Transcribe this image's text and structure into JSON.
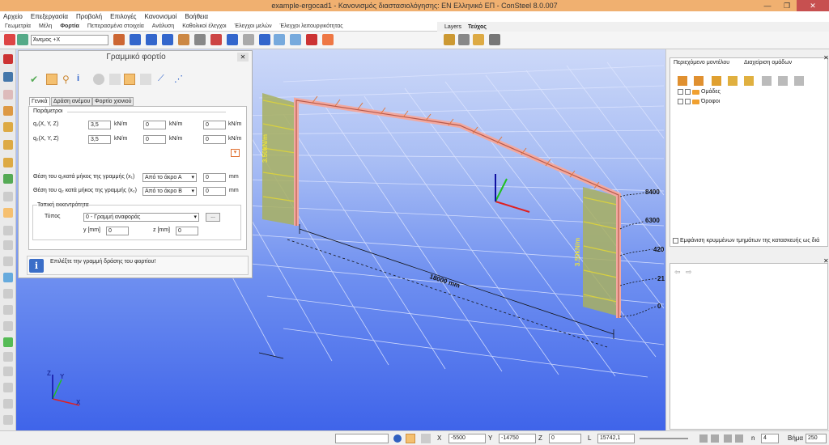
{
  "window": {
    "title": "example-ergocad1 - Κανονισμός διαστασιολόγησης: EN Ελληνικό ΕΠ - ConSteel 8.0.007",
    "controls": [
      "—",
      "❐",
      "✕"
    ]
  },
  "menu": [
    "Αρχείο",
    "Επεξεργασία",
    "Προβολή",
    "Επιλογές",
    "Κανονισμοί",
    "Βοήθεια"
  ],
  "ribbon_tabs": [
    "Γεωμετρία",
    "Μέλη",
    "Φορτία",
    "Πεπερασμένα στοιχεία",
    "Ανάλυση",
    "Καθολικοί έλεγχοι",
    "Έλεγχοι μελών",
    "Έλεγχοι λειτουργικότητας"
  ],
  "ribbon_tabs_right": [
    "Layers",
    "Τεύχος"
  ],
  "load_case": "Άνεμος +X",
  "dialog": {
    "title": "Γραμμικό φορτίο",
    "close": "✕",
    "tabs": [
      "Γενικά",
      "Δράση ανέμου",
      "Φορτίο χιονιού"
    ],
    "section_params": "Παράμετροι",
    "q1_label": "q₁(X, Y, Z)",
    "q2_label": "q₂(X, Y, Z)",
    "q1": [
      "3,5",
      "0",
      "0"
    ],
    "q2": [
      "3,5",
      "0",
      "0"
    ],
    "unit": "kN/m",
    "pos1_label": "Θέση του q₁κατά μήκος της γραμμής (x₁)",
    "pos2_label": "Θέση του q₂ κατά μήκος της γραμμής (x₂)",
    "pos1_select": "Από το άκρο Α",
    "pos2_select": "Από το άκρο Β",
    "pos1_value": "0",
    "pos2_value": "0",
    "mm": "mm",
    "eccentricity_title": "Τοπική εκκεντρότητα",
    "type_label": "Τύπος",
    "type_select": "0 - Γραμμή αναφοράς",
    "more_btn": "...",
    "y_label": "y [mm]",
    "z_label": "z [mm]",
    "y_value": "0",
    "z_value": "0",
    "hint": "Επιλέξτε την γραμμή δράσης του φορτίου!"
  },
  "viewport": {
    "load_left": "3.50kN/m",
    "load_right": "3.50kN/m",
    "dimension": "18000 mm",
    "levels": [
      "8400",
      "6300",
      "420",
      "21",
      "0"
    ],
    "axis_x": "X",
    "axis_y": "Y",
    "axis_z": "Z"
  },
  "right_panel": {
    "tabs": [
      "Περιεχόμενο μοντέλου",
      "Διαχείριση ομάδων"
    ],
    "tree": [
      "Ομάδες",
      "Όροφοι"
    ],
    "show_hidden": "Εμφάνιση κρυμμένων τμημάτων της κατασκευής ως διά",
    "nav": [
      "⇦",
      "⇨"
    ]
  },
  "status": {
    "x_label": "X",
    "y_label": "Y",
    "z_label": "Z",
    "l_label": "L",
    "x": "-5500",
    "y": "-14750",
    "z": "0",
    "l": "15742,1",
    "n_label": "n",
    "n": "4",
    "step_label": "Βήμα",
    "step": "250"
  },
  "colors": {
    "title_bg": "#f0b070",
    "viewport_top": "#ccd8f8",
    "viewport_bottom": "#3f64ea",
    "frame": "#f2a9a0",
    "wind_panel": "#9aa86a"
  }
}
